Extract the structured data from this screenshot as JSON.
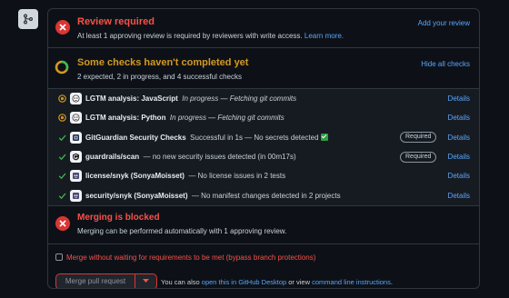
{
  "review": {
    "title": "Review required",
    "message": "At least 1 approving review is required by reviewers with write access.",
    "learn_more": "Learn more.",
    "action": "Add your review"
  },
  "checks": {
    "title": "Some checks haven't completed yet",
    "summary": "2 expected, 2 in progress, and 4 successful checks",
    "toggle": "Hide all checks",
    "rows": [
      {
        "name": "LGTM analysis: JavaScript",
        "desc": "In progress — Fetching git commits",
        "status": "pending",
        "icon": "lgtm-icon",
        "required": "",
        "details": "Details"
      },
      {
        "name": "LGTM analysis: Python",
        "desc": "In progress — Fetching git commits",
        "status": "pending",
        "icon": "lgtm-icon",
        "required": "",
        "details": "Details"
      },
      {
        "name": "GitGuardian Security Checks",
        "desc": "Successful in 1s — No secrets detected",
        "status": "success",
        "icon": "gitguardian-icon",
        "required": "Required",
        "details": "Details"
      },
      {
        "name": "guardrails/scan",
        "desc": "— no new security issues detected (in 00m17s)",
        "status": "success",
        "icon": "guardrails-icon",
        "required": "Required",
        "details": "Details"
      },
      {
        "name": "license/snyk (SonyaMoisset)",
        "desc": "— No license issues in 2 tests",
        "status": "success",
        "icon": "snyk-icon",
        "required": "",
        "details": "Details"
      },
      {
        "name": "security/snyk (SonyaMoisset)",
        "desc": "— No manifest changes detected in 2 projects",
        "status": "success",
        "icon": "snyk-icon",
        "required": "",
        "details": "Details"
      }
    ]
  },
  "blocked": {
    "title": "Merging is blocked",
    "message": "Merging can be performed automatically with 1 approving review."
  },
  "footer": {
    "bypass_label": "Merge without waiting for requirements to be met (bypass branch protections)",
    "merge_button": "Merge pull request",
    "note_prefix": "You can also",
    "desktop_link": "open this in GitHub Desktop",
    "note_mid": "or view",
    "cli_link": "command line instructions",
    "note_end": "."
  },
  "colors": {
    "danger": "#f85149",
    "pending": "#d29922",
    "success": "#3fb950",
    "link": "#58a6ff"
  }
}
